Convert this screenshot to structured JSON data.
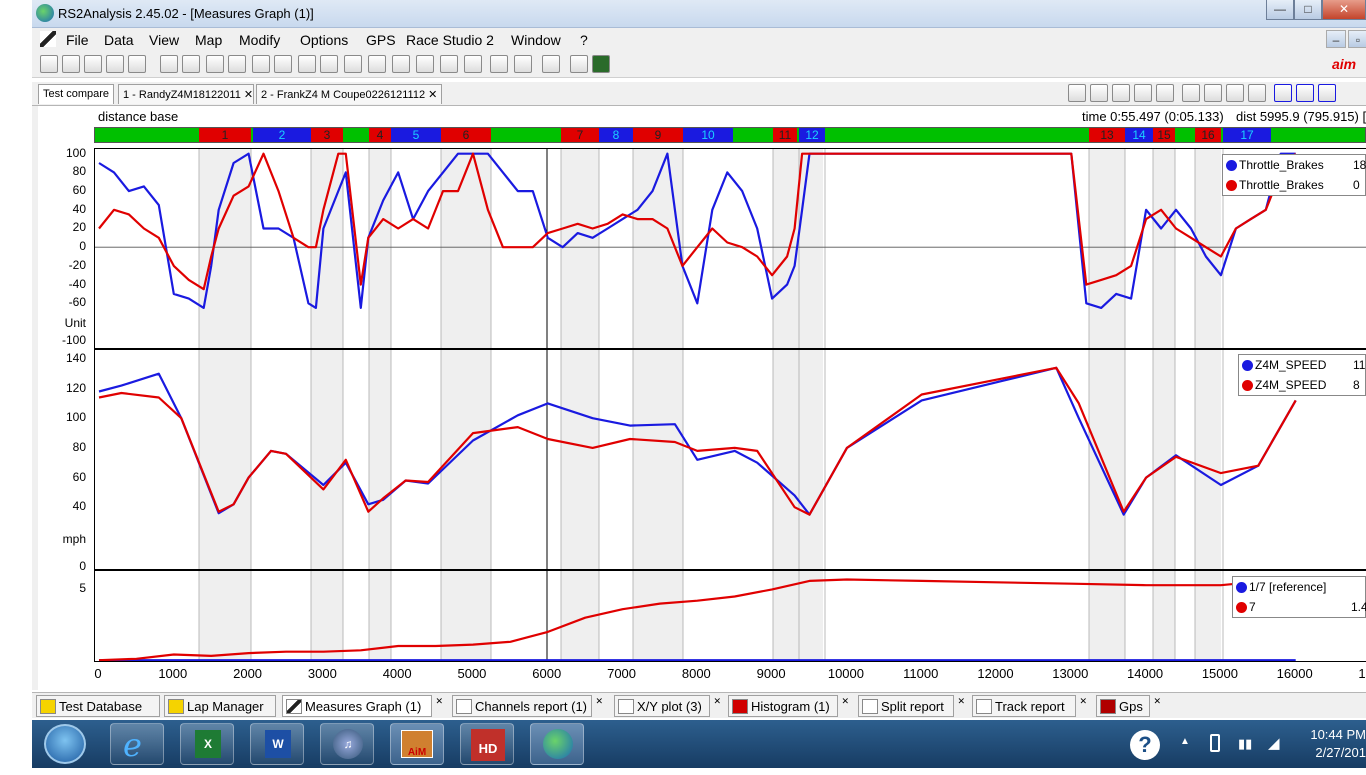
{
  "window": {
    "title": "RS2Analysis 2.45.02 - [Measures Graph (1)]"
  },
  "menu": [
    "File",
    "Data",
    "View",
    "Map",
    "Modify",
    "Options",
    "GPS",
    "Race Studio 2",
    "Window",
    "?"
  ],
  "top_tabs": [
    "Test compare",
    "1 - RandyZ4M18122011",
    "2 - FrankZ4 M Coupe0226121112"
  ],
  "info": {
    "label": "distance base",
    "time": "time 0:55.497 (0:05.133)",
    "dist": "dist 5995.9 (795.915) [f"
  },
  "segments": [
    {
      "n": "1",
      "c": "red"
    },
    {
      "n": "2",
      "c": "blue"
    },
    {
      "n": "3",
      "c": "red"
    },
    {
      "n": "4",
      "c": "red"
    },
    {
      "n": "5",
      "c": "blue"
    },
    {
      "n": "6",
      "c": "red"
    },
    {
      "n": "7",
      "c": "red"
    },
    {
      "n": "8",
      "c": "blue"
    },
    {
      "n": "9",
      "c": "red"
    },
    {
      "n": "10",
      "c": "blue"
    },
    {
      "n": "11",
      "c": "red"
    },
    {
      "n": "12",
      "c": "blue"
    },
    {
      "n": "13",
      "c": "red"
    },
    {
      "n": "14",
      "c": "blue"
    },
    {
      "n": "15",
      "c": "red"
    },
    {
      "n": "16",
      "c": "red"
    },
    {
      "n": "17",
      "c": "blue"
    }
  ],
  "colors": {
    "blue": "#1a1ae0",
    "red": "#e00000",
    "green": "#00c000"
  },
  "chart_data": [
    {
      "type": "line",
      "ylabel": "Unit",
      "ylim": [
        -100,
        100
      ],
      "y_ticks": [
        "100",
        "80",
        "60",
        "40",
        "20",
        "0",
        "-20",
        "-40",
        "-60",
        "-100"
      ],
      "legend": [
        {
          "name": "Throttle_Brakes",
          "value": "18",
          "color": "#1a1ae0"
        },
        {
          "name": "Throttle_Brakes",
          "value": "0",
          "color": "#e00000"
        }
      ],
      "series": [
        {
          "color": "#1a1ae0",
          "x": [
            0,
            200,
            400,
            600,
            800,
            1000,
            1200,
            1400,
            1500,
            1600,
            1800,
            2000,
            2200,
            2400,
            2600,
            2800,
            2900,
            3000,
            3200,
            3300,
            3500,
            3600,
            3800,
            4000,
            4200,
            4400,
            4600,
            4800,
            5000,
            5200,
            5400,
            5600,
            5800,
            6000,
            6200,
            6400,
            6600,
            6800,
            7000,
            7200,
            7400,
            7600,
            7800,
            8000,
            8200,
            8400,
            8600,
            8800,
            9000,
            9200,
            9300,
            9400,
            9500,
            9700,
            9800,
            10000,
            12800,
            13000,
            13200,
            13400,
            13600,
            13800,
            14000,
            14200,
            14400,
            14600,
            14800,
            15000,
            15200,
            15400,
            15600,
            15800,
            16000
          ],
          "y": [
            90,
            80,
            60,
            65,
            45,
            -50,
            -55,
            -65,
            -20,
            40,
            90,
            100,
            20,
            20,
            10,
            -60,
            -65,
            20,
            60,
            80,
            -65,
            10,
            50,
            80,
            30,
            60,
            80,
            100,
            100,
            100,
            80,
            60,
            60,
            10,
            0,
            15,
            10,
            20,
            30,
            40,
            60,
            100,
            -20,
            -60,
            40,
            80,
            60,
            20,
            -55,
            -40,
            -20,
            40,
            100,
            100,
            100,
            100,
            100,
            100,
            -60,
            -65,
            -50,
            -55,
            40,
            20,
            40,
            20,
            -10,
            -30,
            20,
            30,
            40,
            100,
            100
          ]
        },
        {
          "color": "#e00000",
          "x": [
            0,
            200,
            400,
            600,
            800,
            1000,
            1200,
            1400,
            1500,
            1600,
            1800,
            2000,
            2200,
            2400,
            2600,
            2800,
            2900,
            3000,
            3200,
            3300,
            3500,
            3600,
            3800,
            4000,
            4200,
            4400,
            4600,
            4800,
            5000,
            5200,
            5400,
            5600,
            5800,
            6000,
            6200,
            6400,
            6600,
            6800,
            7000,
            7200,
            7400,
            7600,
            7800,
            8000,
            8200,
            8400,
            8600,
            8800,
            9000,
            9200,
            9300,
            9400,
            9500,
            9700,
            9800,
            10000,
            12800,
            13000,
            13200,
            13400,
            13600,
            13800,
            14000,
            14200,
            14400,
            14600,
            14800,
            15000,
            15200,
            15400,
            15600,
            15800,
            16000
          ],
          "y": [
            20,
            40,
            35,
            20,
            10,
            -20,
            -35,
            -45,
            -10,
            20,
            55,
            65,
            100,
            60,
            10,
            0,
            0,
            40,
            100,
            100,
            -40,
            10,
            30,
            20,
            30,
            20,
            60,
            60,
            100,
            40,
            0,
            0,
            0,
            15,
            20,
            25,
            20,
            25,
            35,
            30,
            30,
            20,
            -20,
            0,
            20,
            5,
            0,
            -10,
            -30,
            -10,
            20,
            100,
            100,
            100,
            100,
            100,
            100,
            100,
            -40,
            -35,
            -30,
            -20,
            30,
            40,
            20,
            10,
            0,
            -10,
            20,
            30,
            40,
            80,
            100
          ]
        }
      ]
    },
    {
      "type": "line",
      "ylabel": "mph",
      "ylim": [
        0,
        140
      ],
      "y_ticks": [
        "140",
        "120",
        "100",
        "80",
        "60",
        "40",
        "0"
      ],
      "legend": [
        {
          "name": "Z4M_SPEED",
          "value": "11",
          "color": "#1a1ae0"
        },
        {
          "name": "Z4M_SPEED",
          "value": "8",
          "color": "#e00000"
        }
      ],
      "series": [
        {
          "color": "#1a1ae0",
          "x": [
            0,
            300,
            800,
            1100,
            1600,
            1800,
            2000,
            2300,
            2500,
            3000,
            3300,
            3600,
            3800,
            4100,
            4400,
            5000,
            5600,
            6000,
            6600,
            7100,
            7700,
            8000,
            8500,
            8800,
            9300,
            9500,
            10000,
            11000,
            12800,
            13100,
            13700,
            14000,
            14400,
            15000,
            15500,
            16000
          ],
          "y": [
            118,
            122,
            130,
            100,
            36,
            42,
            60,
            78,
            76,
            55,
            70,
            42,
            45,
            58,
            56,
            85,
            102,
            110,
            100,
            95,
            96,
            72,
            78,
            70,
            48,
            35,
            80,
            112,
            134,
            100,
            35,
            60,
            75,
            55,
            68,
            112
          ]
        },
        {
          "color": "#e00000",
          "x": [
            0,
            300,
            800,
            1100,
            1600,
            1800,
            2000,
            2300,
            2500,
            3000,
            3300,
            3600,
            3800,
            4100,
            4400,
            5000,
            5600,
            6000,
            6600,
            7100,
            7700,
            8000,
            8500,
            8800,
            9300,
            9500,
            10000,
            11000,
            12800,
            13100,
            13700,
            14000,
            14400,
            15000,
            15500,
            16000
          ],
          "y": [
            114,
            117,
            114,
            100,
            37,
            42,
            60,
            78,
            76,
            52,
            72,
            37,
            46,
            58,
            57,
            90,
            94,
            86,
            80,
            86,
            84,
            78,
            80,
            78,
            40,
            35,
            80,
            116,
            134,
            110,
            37,
            60,
            74,
            63,
            68,
            112
          ]
        }
      ]
    },
    {
      "type": "line",
      "ylim": [
        0,
        6
      ],
      "y_ticks": [
        "5"
      ],
      "legend": [
        {
          "name": "1/7 [reference]",
          "value": "",
          "color": "#1a1ae0"
        },
        {
          "name": "7",
          "value": "1.4",
          "color": "#e00000"
        }
      ],
      "series": [
        {
          "color": "#1a1ae0",
          "x": [
            0,
            16000
          ],
          "y": [
            0,
            0
          ]
        },
        {
          "color": "#e00000",
          "x": [
            0,
            500,
            1000,
            1500,
            2000,
            2500,
            3000,
            3500,
            4000,
            4500,
            5000,
            5500,
            6000,
            6500,
            7000,
            7500,
            8000,
            8500,
            9000,
            9500,
            10000,
            11000,
            12000,
            13000,
            14000,
            15000,
            16000
          ],
          "y": [
            0,
            0.1,
            0.4,
            0.3,
            0.5,
            0.6,
            0.6,
            0.7,
            1.0,
            1.0,
            1.1,
            1.3,
            2.0,
            3.0,
            3.6,
            4.0,
            4.2,
            4.5,
            5.0,
            5.6,
            5.7,
            5.6,
            5.5,
            5.4,
            5.3,
            5.3,
            5.8
          ]
        }
      ]
    }
  ],
  "x_axis": {
    "ticks": [
      "0",
      "1000",
      "2000",
      "3000",
      "4000",
      "5000",
      "6000",
      "7000",
      "8000",
      "9000",
      "10000",
      "11000",
      "12000",
      "13000",
      "14000",
      "15000",
      "16000",
      "1"
    ]
  },
  "bottom_tabs": [
    "Test Database",
    "Lap Manager",
    "Measures Graph (1)",
    "Channels report (1)",
    "X/Y plot (3)",
    "Histogram (1)",
    "Split report",
    "Track report",
    "Gps"
  ],
  "clock": {
    "time": "10:44 PM",
    "date": "2/27/201"
  },
  "taskbar": {
    "hd_label": "HD",
    "aim_label": "AiM"
  }
}
